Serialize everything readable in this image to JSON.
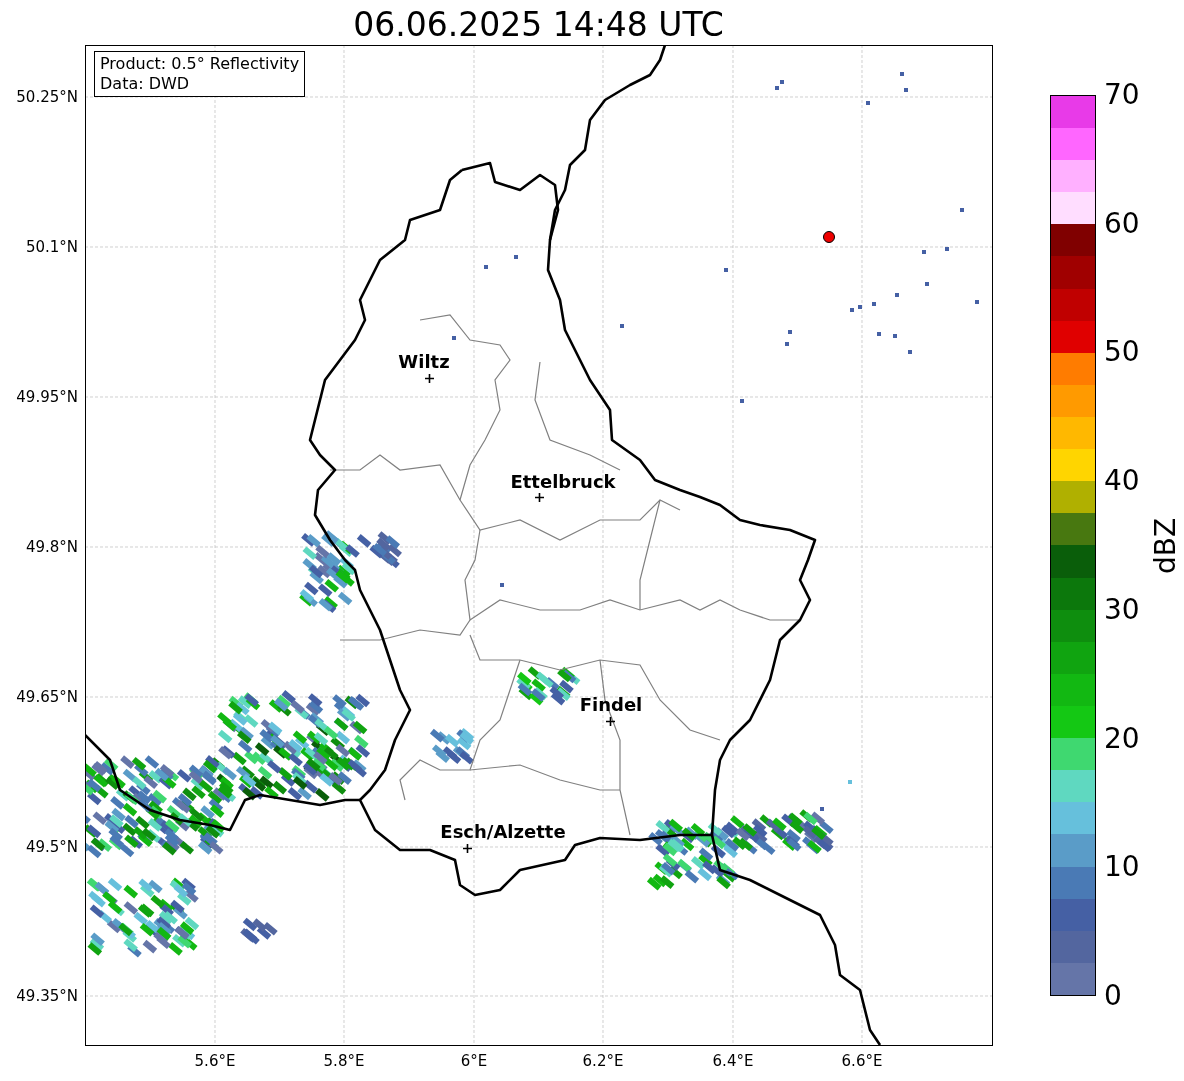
{
  "title": "06.06.2025 14:48 UTC",
  "info_box": {
    "lines": [
      "Product: 0.5° Reflectivity",
      "Data: DWD"
    ]
  },
  "y_ticks": [
    "50.25°N",
    "50.1°N",
    "49.95°N",
    "49.8°N",
    "49.65°N",
    "49.5°N",
    "49.35°N"
  ],
  "x_ticks": [
    "5.6°E",
    "5.8°E",
    "6°E",
    "6.2°E",
    "6.4°E",
    "6.6°E"
  ],
  "cities": [
    {
      "name": "Wiltz"
    },
    {
      "name": "Ettelbruck"
    },
    {
      "name": "Findel"
    },
    {
      "name": "Esch/Alzette"
    }
  ],
  "colorbar": {
    "label": "dBZ",
    "ticks": [
      "70",
      "60",
      "50",
      "40",
      "30",
      "20",
      "10",
      "0"
    ],
    "bands": [
      {
        "color": "#6575a8"
      },
      {
        "color": "#53669f"
      },
      {
        "color": "#4560a4"
      },
      {
        "color": "#4a7ab5"
      },
      {
        "color": "#5a9cc8"
      },
      {
        "color": "#66c0dc"
      },
      {
        "color": "#5fd8c0"
      },
      {
        "color": "#3fd870"
      },
      {
        "color": "#14c814"
      },
      {
        "color": "#12b812"
      },
      {
        "color": "#10a410"
      },
      {
        "color": "#0e8e0e"
      },
      {
        "color": "#0c780c"
      },
      {
        "color": "#0a5e0a"
      },
      {
        "color": "#487810"
      },
      {
        "color": "#b0b000"
      },
      {
        "color": "#ffd500"
      },
      {
        "color": "#ffb800"
      },
      {
        "color": "#ff9a00"
      },
      {
        "color": "#ff7c00"
      },
      {
        "color": "#e00000"
      },
      {
        "color": "#c00000"
      },
      {
        "color": "#a00000"
      },
      {
        "color": "#800000"
      },
      {
        "color": "#ffddff"
      },
      {
        "color": "#ffb0ff"
      },
      {
        "color": "#ff66ff"
      },
      {
        "color": "#e83ae8"
      }
    ]
  }
}
